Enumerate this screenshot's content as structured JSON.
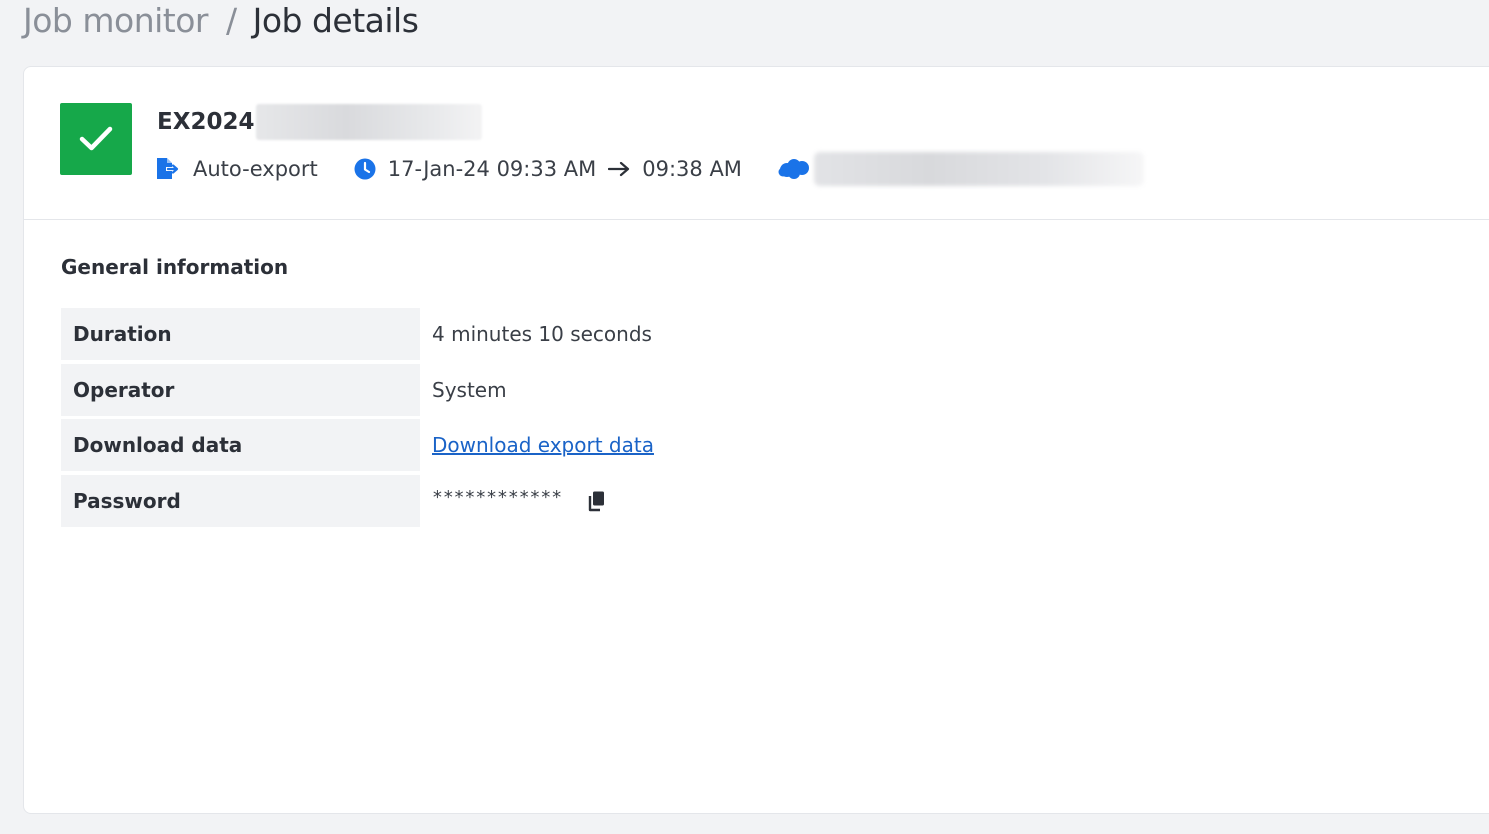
{
  "breadcrumb": {
    "parent": "Job monitor",
    "separator": "/",
    "current": "Job details"
  },
  "job": {
    "status": "success",
    "status_color": "#16a84a",
    "name_prefix": "EX2024",
    "type_icon": "file-export-icon",
    "type": "Auto-export",
    "time_icon": "clock-icon",
    "start_time": "17-Jan-24 09:33 AM",
    "end_time": "09:38 AM",
    "org_icon": "salesforce-cloud-icon"
  },
  "general": {
    "title": "General information",
    "rows": [
      {
        "label": "Duration",
        "value": "4 minutes 10 seconds"
      },
      {
        "label": "Operator",
        "value": "System"
      },
      {
        "label": "Download data",
        "value": "Download export data"
      },
      {
        "label": "Password",
        "value": "************"
      }
    ]
  },
  "colors": {
    "accent": "#1a73e8",
    "link": "#1a63c7",
    "success": "#16a84a",
    "background": "#f2f3f5"
  }
}
